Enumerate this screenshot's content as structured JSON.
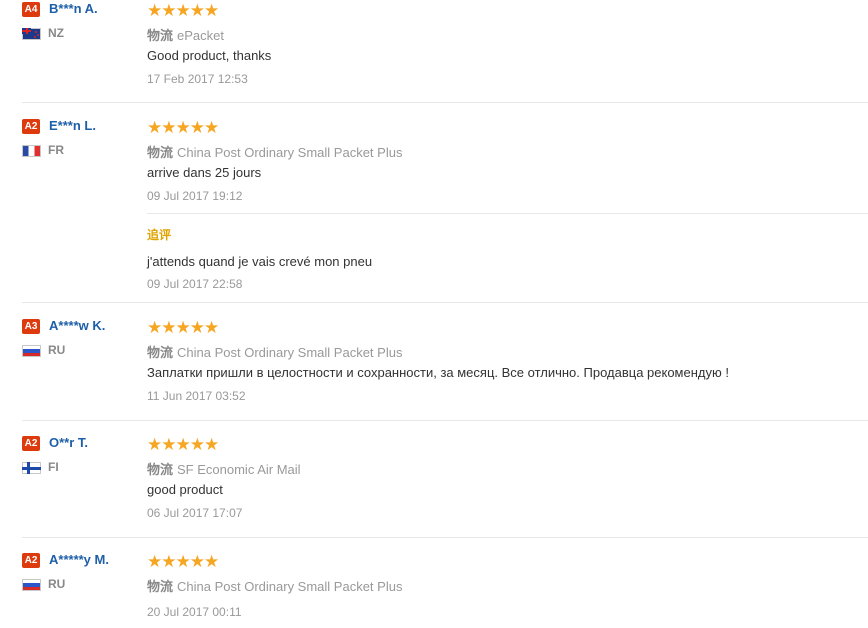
{
  "reviews": [
    {
      "level": "A4",
      "user": "B***n A.",
      "country": "NZ",
      "flag_icon": "flag-nz-icon",
      "rating": 5,
      "stars": "★★★★★",
      "shipping_label": "物流",
      "shipping_method": "ePacket",
      "feedback": "Good product, thanks",
      "date": "17 Feb 2017 12:53"
    },
    {
      "level": "A2",
      "user": "E***n L.",
      "country": "FR",
      "flag_icon": "flag-fr-icon",
      "rating": 5,
      "stars": "★★★★★",
      "shipping_label": "物流",
      "shipping_method": "China Post Ordinary Small Packet Plus",
      "feedback": "arrive dans 25 jours",
      "date": "09 Jul 2017 19:12",
      "followup": {
        "label": "追评",
        "feedback": "j'attends quand je vais crevé mon pneu",
        "date": "09 Jul 2017 22:58"
      }
    },
    {
      "level": "A3",
      "user": "A****w K.",
      "country": "RU",
      "flag_icon": "flag-ru-icon",
      "rating": 5,
      "stars": "★★★★★",
      "shipping_label": "物流",
      "shipping_method": "China Post Ordinary Small Packet Plus",
      "feedback": "Заплатки пришли в целостности и сохранности, за месяц. Все отлично. Продавца рекомендую !",
      "date": "11 Jun 2017 03:52"
    },
    {
      "level": "A2",
      "user": "O**r T.",
      "country": "FI",
      "flag_icon": "flag-fi-icon",
      "rating": 5,
      "stars": "★★★★★",
      "shipping_label": "物流",
      "shipping_method": "SF Economic Air Mail",
      "feedback": "good product",
      "date": "06 Jul 2017 17:07"
    },
    {
      "level": "A2",
      "user": "A*****y M.",
      "country": "RU",
      "flag_icon": "flag-ru-icon",
      "rating": 5,
      "stars": "★★★★★",
      "shipping_label": "物流",
      "shipping_method": "China Post Ordinary Small Packet Plus",
      "feedback": "",
      "date": "20 Jul 2017 00:11"
    }
  ],
  "colors": {
    "level_badge": "#dd3b0e",
    "user_name": "#1d5fa8",
    "stars": "#f5a623",
    "followup_label": "#e0a300"
  }
}
